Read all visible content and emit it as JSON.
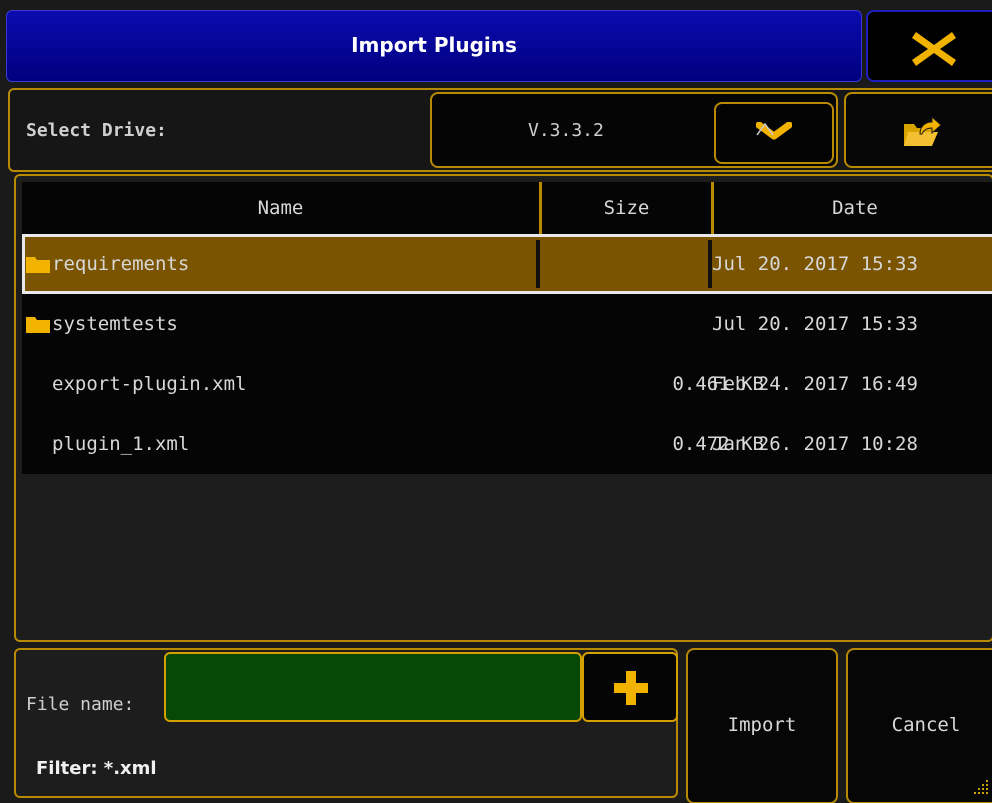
{
  "dialog": {
    "title": "Import Plugins"
  },
  "drive": {
    "label": "Select Drive:",
    "value": "V.3.3.2"
  },
  "table": {
    "columns": [
      "Name",
      "Size",
      "Date"
    ],
    "rows": [
      {
        "name": "requirements",
        "size": "",
        "date": "Jul 20. 2017 15:33",
        "type": "folder",
        "selected": true
      },
      {
        "name": "systemtests",
        "size": "",
        "date": "Jul 20. 2017 15:33",
        "type": "folder",
        "selected": false
      },
      {
        "name": "export-plugin.xml",
        "size": "0.461 KB",
        "date": "Feb 24. 2017 16:49",
        "type": "file",
        "selected": false
      },
      {
        "name": "plugin_1.xml",
        "size": "0.472 KB",
        "date": "Jan 26. 2017 10:28",
        "type": "file",
        "selected": false
      }
    ]
  },
  "bottom": {
    "file_name_label": "File name:",
    "file_name_value": "",
    "filter_label": "Filter: *.xml"
  },
  "buttons": {
    "import": "Import",
    "cancel": "Cancel"
  },
  "icons": {
    "close": "close-icon",
    "dropdown": "chevron-down-icon",
    "folder_up": "folder-up-icon",
    "folder": "folder-icon",
    "add": "plus-icon"
  },
  "colors": {
    "accent": "#b88a00",
    "title_bg": "#00007e",
    "selected_row": "#7a5400",
    "input_bg": "#064806"
  }
}
